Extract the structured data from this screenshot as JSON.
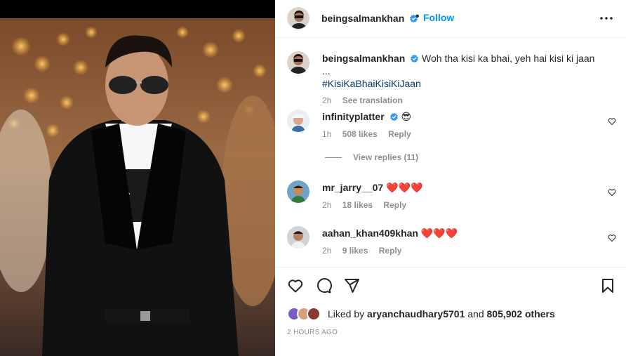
{
  "post": {
    "username": "beingsalmankhan",
    "follow_label": "Follow",
    "dot": "•"
  },
  "caption": {
    "username": "beingsalmankhan",
    "text": "Woh tha kisi ka bhai, yeh hai kisi ki jaan ...",
    "hashtag": "#KisiKaBhaiKisiKiJaan",
    "time": "2h",
    "see_translation": "See translation"
  },
  "comments": [
    {
      "username": "infinityplatter",
      "text": "😎",
      "time": "1h",
      "likes": "508 likes",
      "reply": "Reply",
      "verified": true
    },
    {
      "username": "mr_jarry__07",
      "text": "❤️❤️❤️",
      "time": "2h",
      "likes": "18 likes",
      "reply": "Reply",
      "verified": false
    },
    {
      "username": "aahan_khan409khan",
      "text": "❤️❤️❤️",
      "time": "2h",
      "likes": "9 likes",
      "reply": "Reply",
      "verified": false
    }
  ],
  "view_replies": "View replies (11)",
  "likes": {
    "prefix": "Liked by ",
    "user": "aryanchaudhary5701",
    "middle": " and ",
    "others": "805,902 others"
  },
  "timestamp": "2 HOURS AGO",
  "icons": {
    "header_more": "more-horizontal-icon",
    "like": "heart-icon",
    "comment": "comment-bubble-icon",
    "share": "paper-plane-icon",
    "save": "bookmark-icon"
  },
  "colors": {
    "accent": "#0095f6",
    "verified": "#3897f0",
    "hashtag": "#00376b",
    "muted": "#8e8e8e",
    "heart": "#ed4956"
  }
}
